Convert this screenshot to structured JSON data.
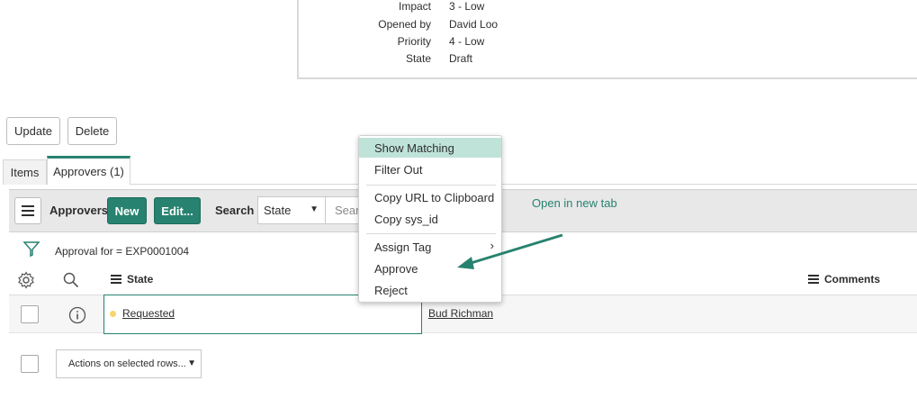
{
  "detail": {
    "fields": [
      {
        "label": "Impact",
        "value": "3 - Low"
      },
      {
        "label": "Opened by",
        "value": "David Loo"
      },
      {
        "label": "Priority",
        "value": "4 - Low"
      },
      {
        "label": "State",
        "value": "Draft"
      }
    ]
  },
  "form_buttons": {
    "update": "Update",
    "delete": "Delete"
  },
  "tabs": [
    {
      "label": "Items"
    },
    {
      "label": "Approvers (1)"
    }
  ],
  "list": {
    "title": "Approvers",
    "new_label": "New",
    "edit_label": "Edit...",
    "search_label": "Search",
    "search_field": "State",
    "search_placeholder": "Search",
    "filter_text": "Approval for = EXP0001004",
    "columns": {
      "state": "State",
      "comments": "Comments"
    },
    "rows": [
      {
        "state": "Requested",
        "approver": "Bud Richman"
      }
    ],
    "actions_label": "Actions on selected rows..."
  },
  "context_menu": {
    "items": [
      "Show Matching",
      "Filter Out",
      "Copy URL to Clipboard",
      "Copy sys_id",
      "Assign Tag",
      "Approve",
      "Reject"
    ]
  },
  "annotation": {
    "text": "Open in new tab"
  },
  "colors": {
    "accent": "#27826f",
    "highlight": "#bfe3d9",
    "state_dot": "#f5d76e"
  },
  "icons": [
    "hamburger-icon",
    "filter-funnel-icon",
    "gear-icon",
    "search-icon",
    "list-icon",
    "info-icon",
    "chevron-right-icon",
    "caret-down-icon",
    "arrow-icon"
  ]
}
